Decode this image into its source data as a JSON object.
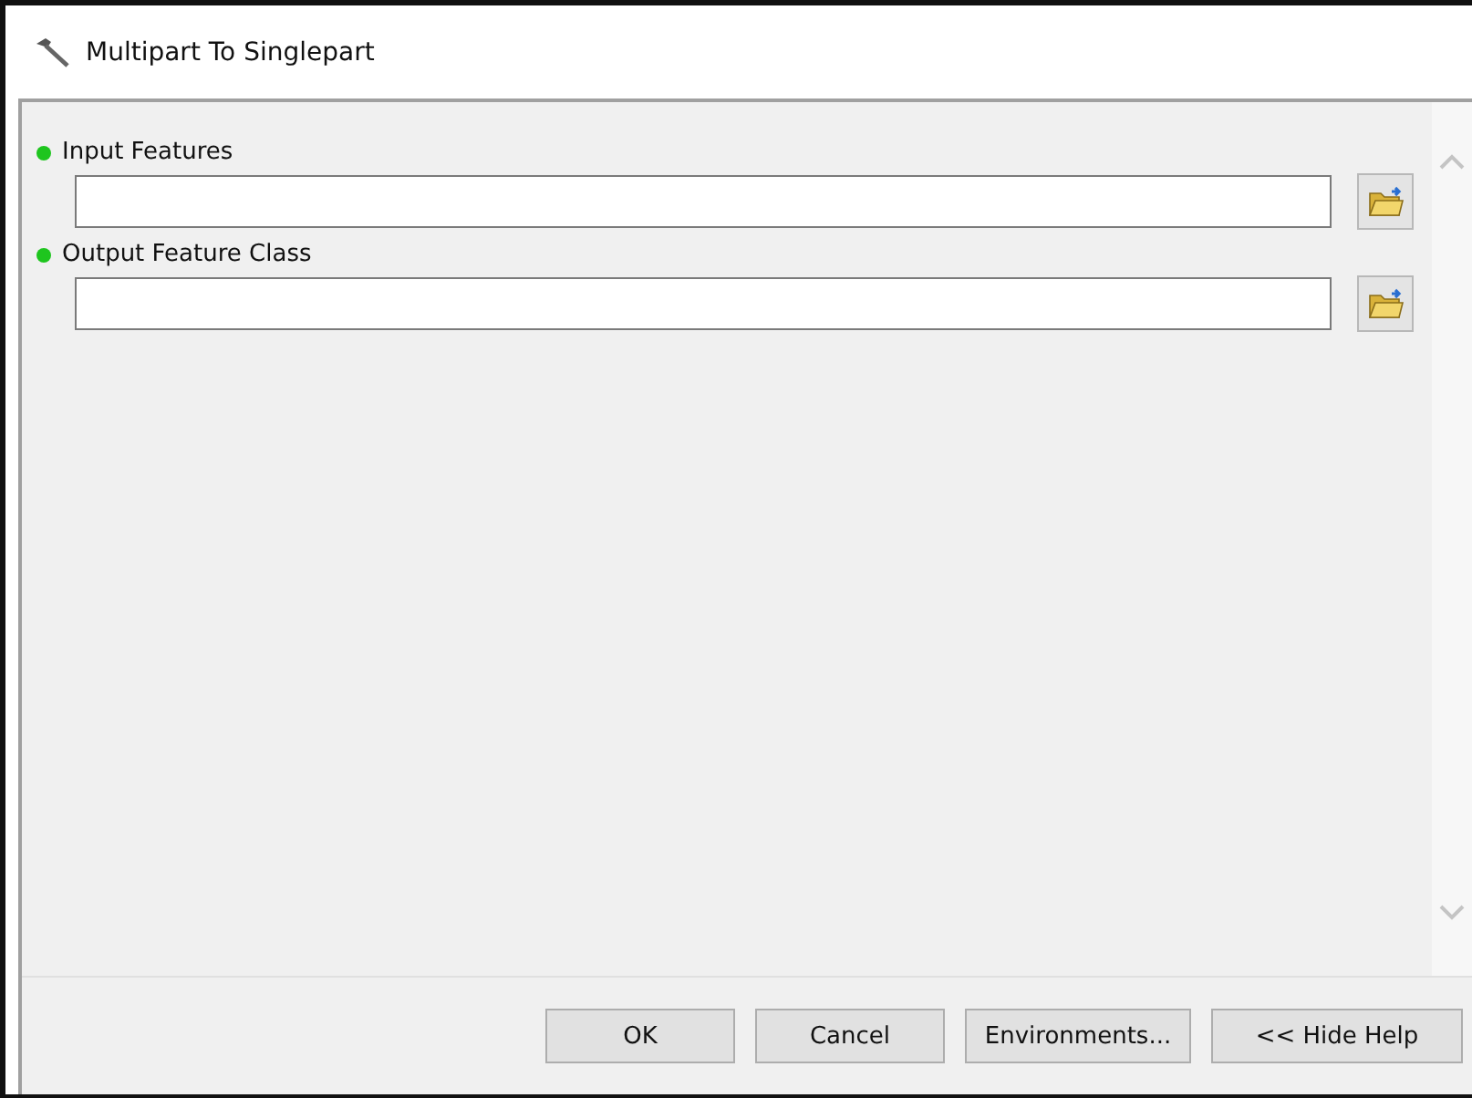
{
  "window": {
    "title": "Multipart To Singlepart"
  },
  "parameters": [
    {
      "label": "Input Features",
      "required": true
    },
    {
      "label": "Output Feature Class",
      "required": true
    }
  ],
  "buttons": [
    "OK",
    "Cancel",
    "Environments...",
    "<< Hide Help"
  ]
}
